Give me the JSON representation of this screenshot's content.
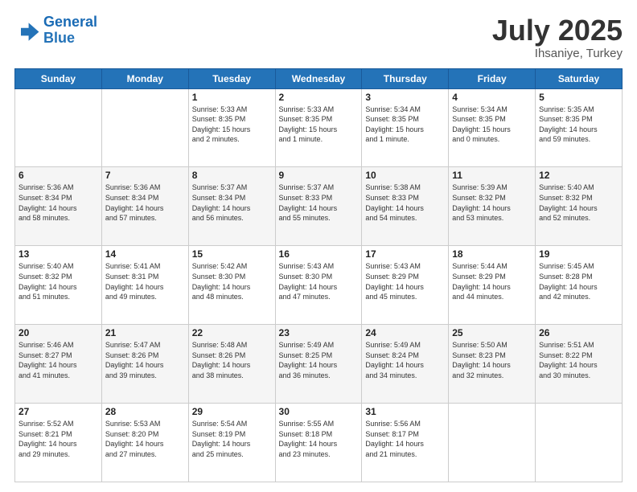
{
  "header": {
    "logo_line1": "General",
    "logo_line2": "Blue",
    "title": "July 2025",
    "location": "Ihsaniye, Turkey"
  },
  "days_of_week": [
    "Sunday",
    "Monday",
    "Tuesday",
    "Wednesday",
    "Thursday",
    "Friday",
    "Saturday"
  ],
  "weeks": [
    [
      {
        "day": "",
        "info": ""
      },
      {
        "day": "",
        "info": ""
      },
      {
        "day": "1",
        "info": "Sunrise: 5:33 AM\nSunset: 8:35 PM\nDaylight: 15 hours\nand 2 minutes."
      },
      {
        "day": "2",
        "info": "Sunrise: 5:33 AM\nSunset: 8:35 PM\nDaylight: 15 hours\nand 1 minute."
      },
      {
        "day": "3",
        "info": "Sunrise: 5:34 AM\nSunset: 8:35 PM\nDaylight: 15 hours\nand 1 minute."
      },
      {
        "day": "4",
        "info": "Sunrise: 5:34 AM\nSunset: 8:35 PM\nDaylight: 15 hours\nand 0 minutes."
      },
      {
        "day": "5",
        "info": "Sunrise: 5:35 AM\nSunset: 8:35 PM\nDaylight: 14 hours\nand 59 minutes."
      }
    ],
    [
      {
        "day": "6",
        "info": "Sunrise: 5:36 AM\nSunset: 8:34 PM\nDaylight: 14 hours\nand 58 minutes."
      },
      {
        "day": "7",
        "info": "Sunrise: 5:36 AM\nSunset: 8:34 PM\nDaylight: 14 hours\nand 57 minutes."
      },
      {
        "day": "8",
        "info": "Sunrise: 5:37 AM\nSunset: 8:34 PM\nDaylight: 14 hours\nand 56 minutes."
      },
      {
        "day": "9",
        "info": "Sunrise: 5:37 AM\nSunset: 8:33 PM\nDaylight: 14 hours\nand 55 minutes."
      },
      {
        "day": "10",
        "info": "Sunrise: 5:38 AM\nSunset: 8:33 PM\nDaylight: 14 hours\nand 54 minutes."
      },
      {
        "day": "11",
        "info": "Sunrise: 5:39 AM\nSunset: 8:32 PM\nDaylight: 14 hours\nand 53 minutes."
      },
      {
        "day": "12",
        "info": "Sunrise: 5:40 AM\nSunset: 8:32 PM\nDaylight: 14 hours\nand 52 minutes."
      }
    ],
    [
      {
        "day": "13",
        "info": "Sunrise: 5:40 AM\nSunset: 8:32 PM\nDaylight: 14 hours\nand 51 minutes."
      },
      {
        "day": "14",
        "info": "Sunrise: 5:41 AM\nSunset: 8:31 PM\nDaylight: 14 hours\nand 49 minutes."
      },
      {
        "day": "15",
        "info": "Sunrise: 5:42 AM\nSunset: 8:30 PM\nDaylight: 14 hours\nand 48 minutes."
      },
      {
        "day": "16",
        "info": "Sunrise: 5:43 AM\nSunset: 8:30 PM\nDaylight: 14 hours\nand 47 minutes."
      },
      {
        "day": "17",
        "info": "Sunrise: 5:43 AM\nSunset: 8:29 PM\nDaylight: 14 hours\nand 45 minutes."
      },
      {
        "day": "18",
        "info": "Sunrise: 5:44 AM\nSunset: 8:29 PM\nDaylight: 14 hours\nand 44 minutes."
      },
      {
        "day": "19",
        "info": "Sunrise: 5:45 AM\nSunset: 8:28 PM\nDaylight: 14 hours\nand 42 minutes."
      }
    ],
    [
      {
        "day": "20",
        "info": "Sunrise: 5:46 AM\nSunset: 8:27 PM\nDaylight: 14 hours\nand 41 minutes."
      },
      {
        "day": "21",
        "info": "Sunrise: 5:47 AM\nSunset: 8:26 PM\nDaylight: 14 hours\nand 39 minutes."
      },
      {
        "day": "22",
        "info": "Sunrise: 5:48 AM\nSunset: 8:26 PM\nDaylight: 14 hours\nand 38 minutes."
      },
      {
        "day": "23",
        "info": "Sunrise: 5:49 AM\nSunset: 8:25 PM\nDaylight: 14 hours\nand 36 minutes."
      },
      {
        "day": "24",
        "info": "Sunrise: 5:49 AM\nSunset: 8:24 PM\nDaylight: 14 hours\nand 34 minutes."
      },
      {
        "day": "25",
        "info": "Sunrise: 5:50 AM\nSunset: 8:23 PM\nDaylight: 14 hours\nand 32 minutes."
      },
      {
        "day": "26",
        "info": "Sunrise: 5:51 AM\nSunset: 8:22 PM\nDaylight: 14 hours\nand 30 minutes."
      }
    ],
    [
      {
        "day": "27",
        "info": "Sunrise: 5:52 AM\nSunset: 8:21 PM\nDaylight: 14 hours\nand 29 minutes."
      },
      {
        "day": "28",
        "info": "Sunrise: 5:53 AM\nSunset: 8:20 PM\nDaylight: 14 hours\nand 27 minutes."
      },
      {
        "day": "29",
        "info": "Sunrise: 5:54 AM\nSunset: 8:19 PM\nDaylight: 14 hours\nand 25 minutes."
      },
      {
        "day": "30",
        "info": "Sunrise: 5:55 AM\nSunset: 8:18 PM\nDaylight: 14 hours\nand 23 minutes."
      },
      {
        "day": "31",
        "info": "Sunrise: 5:56 AM\nSunset: 8:17 PM\nDaylight: 14 hours\nand 21 minutes."
      },
      {
        "day": "",
        "info": ""
      },
      {
        "day": "",
        "info": ""
      }
    ]
  ]
}
